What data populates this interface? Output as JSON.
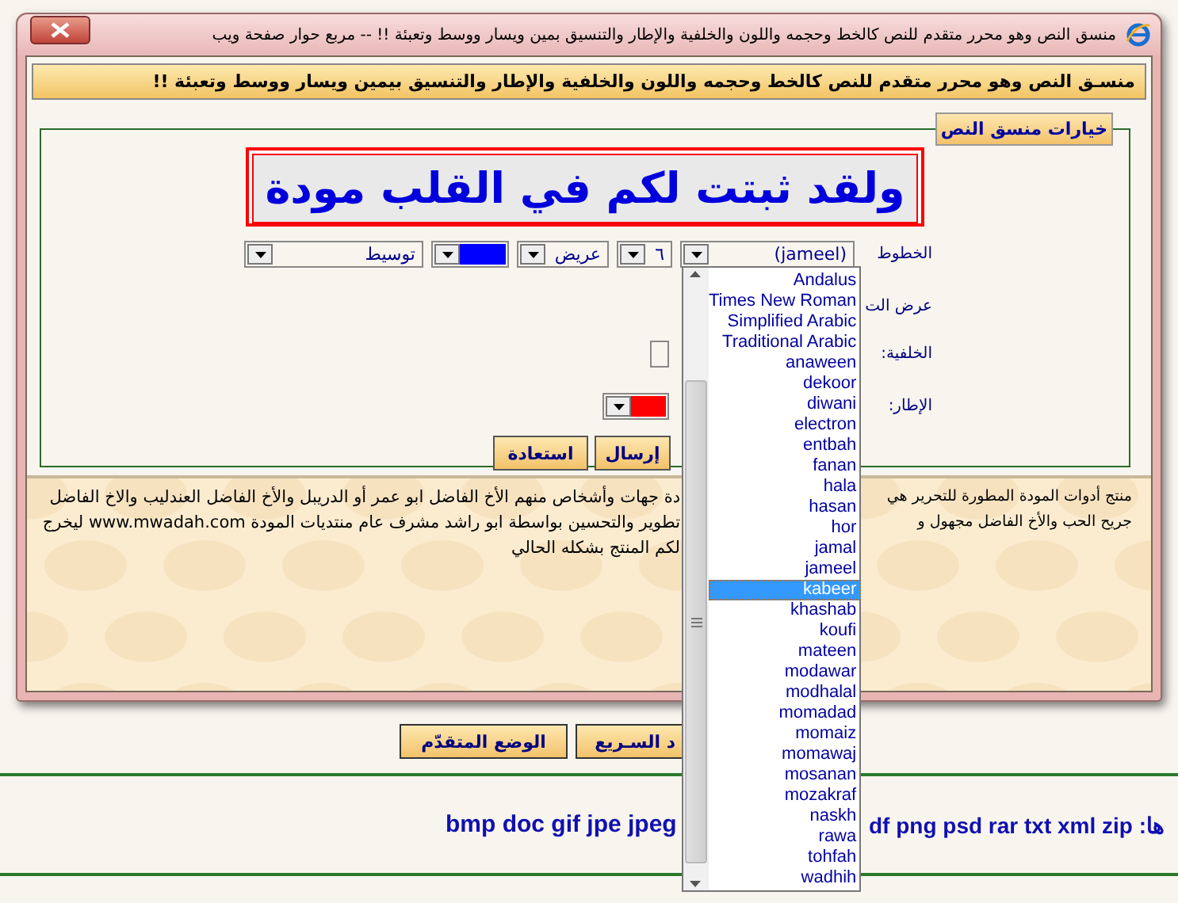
{
  "dialog": {
    "title": "منسق النص وهو محرر متقدم للنص كالخط وحجمه واللون والخلفية والإطار والتنسيق بمين ويسار ووسط وتعبئة !! -- مربع حوار صفحة ويب",
    "header": "منسـق النص وهو محرر متقدم للنص كالخط وحجمه واللون والخلفية والإطار والتنسيق بيمين ويسار ووسط وتعبئة !!",
    "legend": "خيارات منسق النص",
    "preview_text": "ولقد ثبتت لكم في القلب مودة",
    "rows": [
      {
        "label": "الخطوط",
        "controls": [
          {
            "kind": "select",
            "value": "(jameel)"
          },
          {
            "kind": "select",
            "value": "٦"
          },
          {
            "kind": "select",
            "value": "عريض"
          },
          {
            "kind": "color",
            "color": "#0000ff"
          },
          {
            "kind": "select",
            "value": "توسيط"
          }
        ]
      },
      {
        "label": "عرض الت",
        "controls": []
      },
      {
        "label": "الخلفية:",
        "controls": [
          {
            "kind": "select"
          }
        ]
      },
      {
        "label": "الإطار:",
        "controls": [
          {
            "kind": "color",
            "color": "#ff0000"
          }
        ]
      }
    ],
    "buttons": [
      "إرسال",
      "استعادة"
    ],
    "paragraph_right": [
      "منتج أدوات المودة المطورة للتحرير هي",
      "جريح الحب والأخ الفاضل مجهول و"
    ],
    "paragraph_left": [
      "دة جهات وأشخاص منهم الأخ الفاضل ابو عمر أو الدريبل والأخ الفاضل العندليب والاخ الفاضل",
      "تطوير والتحسين بواسطة ابو راشد مشرف عام منتديات المودة www.mwadah.com ليخرج",
      "لكم المنتج بشكله الحالي"
    ]
  },
  "font_list": {
    "items": [
      {
        "label": "Andalus",
        "selected": false
      },
      {
        "label": "Times New Roman",
        "selected": false
      },
      {
        "label": "Simplified Arabic",
        "selected": false
      },
      {
        "label": "Traditional Arabic",
        "selected": false
      },
      {
        "label": "anaween",
        "selected": false
      },
      {
        "label": "dekoor",
        "selected": false
      },
      {
        "label": "diwani",
        "selected": false
      },
      {
        "label": "electron",
        "selected": false
      },
      {
        "label": "entbah",
        "selected": false
      },
      {
        "label": "fanan",
        "selected": false
      },
      {
        "label": "hala",
        "selected": false
      },
      {
        "label": "hasan",
        "selected": false
      },
      {
        "label": "hor",
        "selected": false
      },
      {
        "label": "jamal",
        "selected": false
      },
      {
        "label": "jameel",
        "selected": false
      },
      {
        "label": "kabeer",
        "selected": true
      },
      {
        "label": "khashab",
        "selected": false
      },
      {
        "label": "koufi",
        "selected": false
      },
      {
        "label": "mateen",
        "selected": false
      },
      {
        "label": "modawar",
        "selected": false
      },
      {
        "label": "modhalal",
        "selected": false
      },
      {
        "label": "momadad",
        "selected": false
      },
      {
        "label": "momaiz",
        "selected": false
      },
      {
        "label": "momawaj",
        "selected": false
      },
      {
        "label": "mosanan",
        "selected": false
      },
      {
        "label": "mozakraf",
        "selected": false
      },
      {
        "label": "naskh",
        "selected": false
      },
      {
        "label": "rawa",
        "selected": false
      },
      {
        "label": "tohfah",
        "selected": false
      },
      {
        "label": "wadhih",
        "selected": false
      }
    ]
  },
  "page": {
    "buttons": [
      "د السـريع",
      "الوضع المتقدّم"
    ],
    "extensions_left": "bmp doc gif jpe jpeg",
    "extensions_right": "df png psd rar txt xml zip :ها"
  }
}
